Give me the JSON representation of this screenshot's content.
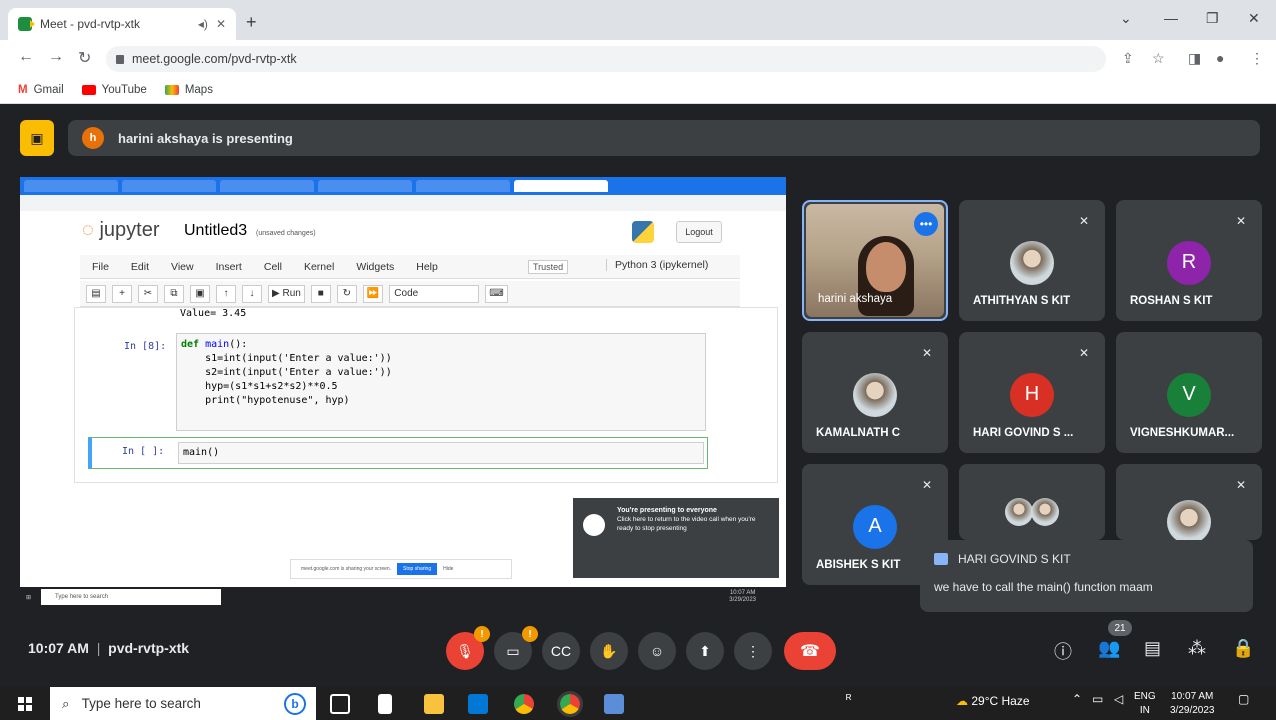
{
  "browser": {
    "tab_title": "Meet - pvd-rvtp-xtk",
    "url": "meet.google.com/pvd-rvtp-xtk",
    "bookmarks": [
      "Gmail",
      "YouTube",
      "Maps"
    ]
  },
  "meet": {
    "presenting_banner": "harini akshaya is presenting",
    "presenter_initial": "h",
    "time": "10:07 AM",
    "separator": "|",
    "meeting_code": "pvd-rvtp-xtk",
    "participant_count": "21",
    "participants": [
      {
        "name": "harini akshaya"
      },
      {
        "name": "ATHITHYAN S KIT"
      },
      {
        "name": "ROSHAN S KIT",
        "initial": "R",
        "color": "#8e24aa"
      },
      {
        "name": "KAMALNATH C"
      },
      {
        "name": "HARI GOVIND S ...",
        "initial": "H",
        "color": "#d93025"
      },
      {
        "name": "VIGNESHKUMAR...",
        "initial": "V",
        "color": "#188038"
      },
      {
        "name": "ABISHEK S KIT",
        "initial": "A",
        "color": "#1a73e8"
      }
    ],
    "chat": {
      "sender": "HARI GOVIND S KIT",
      "message": "we have to call the main() function maam"
    },
    "colors": {
      "accent": "#1a73e8",
      "end_call": "#ea4335",
      "warning": "#fbbc04"
    }
  },
  "shared_screen": {
    "notebook_logo": "jupyter",
    "notebook_name": "Untitled3",
    "unsaved": "(unsaved changes)",
    "logout": "Logout",
    "menu": [
      "File",
      "Edit",
      "View",
      "Insert",
      "Cell",
      "Kernel",
      "Widgets",
      "Help"
    ],
    "trusted": "Trusted",
    "kernel": "Python 3 (ipykernel)",
    "run_label": "Run",
    "cell_type": "Code",
    "output_prev": "Value= 3.45",
    "cell1_prompt": "In [8]:",
    "cell1_lines": [
      "def main():",
      "    s1=int(input('Enter a value:'))",
      "    s2=int(input('Enter a value:'))",
      "    hyp=(s1*s1+s2*s2)**0.5",
      "    print(\"hypotenuse\", hyp)"
    ],
    "cell2_prompt": "In [ ]:",
    "cell2_code": "main()",
    "toast_title": "You're presenting to everyone",
    "toast_body": "Click here to return to the video call when you're ready to stop presenting",
    "sharebar_text": "meet.google.com is sharing your screen.",
    "sharebar_stop": "Stop sharing",
    "sharebar_hide": "Hide",
    "taskbar_search": "Type here to search",
    "clock_time": "10:07 AM",
    "clock_date": "3/29/2023"
  },
  "taskbar": {
    "search_placeholder": "Type here to search",
    "weather": "29°C Haze",
    "lang1": "ENG",
    "lang2": "IN",
    "time": "10:07 AM",
    "date": "3/29/2023"
  }
}
